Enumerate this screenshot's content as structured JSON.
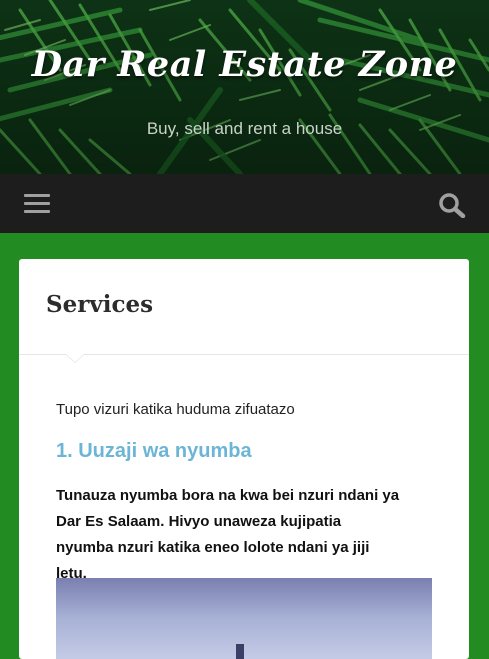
{
  "header": {
    "site_title": "Dar Real Estate Zone",
    "tagline": "Buy, sell and rent a house"
  },
  "nav": {
    "menu_icon": "hamburger-menu-icon",
    "search_icon": "search-icon"
  },
  "page": {
    "title": "Services",
    "intro": "Tupo vizuri katika huduma zifuatazo",
    "section_heading": "1. Uuzaji wa nyumba",
    "paragraph": "Tunauza nyumba bora na kwa bei nzuri ndani ya Dar Es Salaam. Hivyo unaweza kujipatia nyumba nzuri katika eneo lolote ndani ya jiji letu."
  },
  "colors": {
    "background_green": "#228b22",
    "nav_dark": "#1d1d1d",
    "heading_blue": "#6db5d6"
  }
}
